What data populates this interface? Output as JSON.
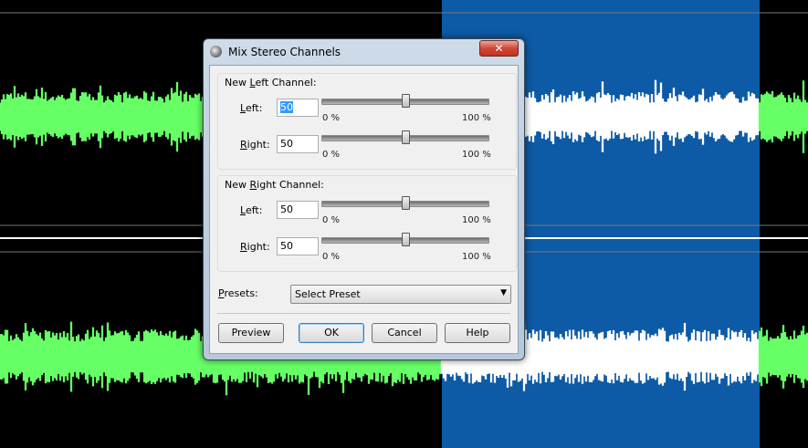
{
  "dialog": {
    "title": "Mix Stereo Channels",
    "close_glyph": "✕",
    "left_group_title_pre": "New ",
    "left_group_title_key": "L",
    "left_group_title_post": "eft Channel:",
    "right_group_title_pre": "New ",
    "right_group_title_key": "R",
    "right_group_title_post": "ight Channel:",
    "rows": [
      {
        "label_key": "L",
        "label_rest": "eft:",
        "value": "50",
        "level": 0.5,
        "min_label": "0 %",
        "max_label": "100 %"
      },
      {
        "label_key": "R",
        "label_rest": "ight:",
        "value": "50",
        "level": 0.5,
        "min_label": "0 %",
        "max_label": "100 %"
      },
      {
        "label_key": "L",
        "label_rest": "eft:",
        "value": "50",
        "level": 0.5,
        "min_label": "0 %",
        "max_label": "100 %"
      },
      {
        "label_key": "R",
        "label_rest": "ight:",
        "value": "50",
        "level": 0.5,
        "min_label": "0 %",
        "max_label": "100 %"
      }
    ],
    "presets_key": "P",
    "presets_rest": "resets:",
    "presets_value": "Select Preset",
    "buttons": {
      "preview": "Preview",
      "ok": "OK",
      "cancel": "Cancel",
      "help": "Help"
    }
  },
  "colors": {
    "waveform": "#66ff66",
    "selection_bg": "#0d5aa6",
    "selection_wave": "#ffffff",
    "background": "#000000"
  },
  "icons": {
    "app": "app-icon",
    "close": "close-icon",
    "dropdown": "chevron-down-icon"
  }
}
